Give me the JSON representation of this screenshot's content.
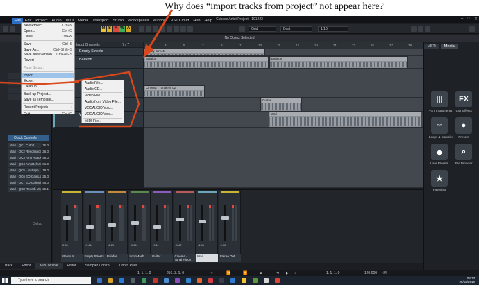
{
  "question": "Why does “import tracks from project” not appear here?",
  "app": {
    "title": "Cubase Artist Project - 191222",
    "menubar": [
      "File",
      "Edit",
      "Project",
      "Audio",
      "MIDI",
      "Media",
      "Transport",
      "Studio",
      "Workspaces",
      "Window",
      "VST Cloud",
      "Hub",
      "Help"
    ],
    "msrw": [
      "M",
      "S",
      "R",
      "W",
      "A"
    ],
    "grid_label": "Grid",
    "snap_value": "Beat",
    "quantize_value": "1/16",
    "info_line": "No Object Selected",
    "colors": {
      "accent": "#2d6fc3",
      "menu_highlight": "#9ec3ea",
      "annotation": "#d9471a"
    }
  },
  "file_menu": [
    {
      "label": "New Project...",
      "shortcut": "Ctrl+N"
    },
    {
      "label": "Open...",
      "shortcut": "Ctrl+O"
    },
    {
      "label": "Close",
      "shortcut": "Ctrl+W"
    },
    {
      "label": "Save",
      "shortcut": "Ctrl+S"
    },
    {
      "label": "Save As...",
      "shortcut": "Ctrl+Shift+S"
    },
    {
      "label": "Save New Version",
      "shortcut": "Ctrl+Alt+S"
    },
    {
      "label": "Revert",
      "shortcut": ""
    },
    {
      "label": "Page Setup...",
      "shortcut": ""
    },
    {
      "label": "Import",
      "shortcut": ""
    },
    {
      "label": "Export",
      "shortcut": ""
    },
    {
      "label": "Cleanup...",
      "shortcut": ""
    },
    {
      "label": "Back up Project...",
      "shortcut": ""
    },
    {
      "label": "Save as Template...",
      "shortcut": ""
    },
    {
      "label": "Recent Projects",
      "shortcut": ""
    },
    {
      "label": "Quit",
      "shortcut": "Ctrl+Q"
    }
  ],
  "import_submenu": [
    "Audio File...",
    "Audio CD...",
    "Video File...",
    "Audio from Video File...",
    "VOCALOID Voic...",
    "VOCALOID Voic...",
    "MIDI File..."
  ],
  "inspector": {
    "header": "Input Channels",
    "quick_controls_title": "Quick Controls",
    "quick_controls": [
      {
        "name": "Wail - QC1 Cutoff",
        "value": "75.0"
      },
      {
        "name": "Wail - QC2 Resonance",
        "value": "26.0"
      },
      {
        "name": "Wail - QC3 Amp Attack",
        "value": "48.0"
      },
      {
        "name": "Wail - QC4 AmpRelease",
        "value": "61.0"
      },
      {
        "name": "Wail - QC5 ...oshape",
        "value": "18.0"
      },
      {
        "name": "Wail - QC6 EQ GainLow",
        "value": "25.0"
      },
      {
        "name": "Wail - QC7 EQ GainMid",
        "value": "45.0"
      },
      {
        "name": "Wail - QC8 Reverb Mix",
        "value": "25.1"
      }
    ],
    "setup_label": "Setup"
  },
  "tracks": {
    "counter": "7 / 7",
    "rows": [
      "Empty Streets",
      "Balafon",
      "",
      "",
      "",
      "Wail"
    ]
  },
  "arrange": {
    "ruler": [
      "1",
      "3",
      "5",
      "7",
      "9",
      "11",
      "13",
      "15",
      "17",
      "19",
      "21",
      "23",
      "25",
      "27",
      "29"
    ],
    "clips": [
      {
        "name": "Empty Streets",
        "row": 0
      },
      {
        "name": "Balafon",
        "row": 1
      },
      {
        "name": "Balafon",
        "row": 1
      },
      {
        "name": "Cinema - Tonal Hit 02",
        "row": 3
      },
      {
        "name": "Guitar",
        "row": 4
      },
      {
        "name": "Wail",
        "row": 5
      }
    ]
  },
  "media": {
    "tabs": [
      "VSTi",
      "Media"
    ],
    "items": [
      {
        "label": "VST Instruments",
        "glyph": "|||"
      },
      {
        "label": "VST Effects",
        "glyph": "FX"
      },
      {
        "label": "Loops & Samples",
        "glyph": "◦◦"
      },
      {
        "label": "Presets",
        "glyph": "●"
      },
      {
        "label": "User Presets",
        "glyph": "◆"
      },
      {
        "label": "File Browser",
        "glyph": "⌕"
      },
      {
        "label": "Favorites",
        "glyph": "★"
      }
    ]
  },
  "mixer": {
    "strips": [
      {
        "name": "Stereo In",
        "db": "0.00",
        "vol": "0.00"
      },
      {
        "name": "Empty Streets",
        "db": "-9.44",
        "vol": "0.00"
      },
      {
        "name": "Balafon",
        "db": "-6.89",
        "vol": "0.00"
      },
      {
        "name": "LoopMash",
        "db": "-9.16",
        "vol": "0.00"
      },
      {
        "name": "Guitar",
        "db": "-9.11",
        "vol": "0.00"
      },
      {
        "name": "Cinema - Tonal Hit 02",
        "db": "-1.47",
        "vol": "0.00"
      },
      {
        "name": "Wail",
        "db": "-1.91",
        "vol": "0.00"
      },
      {
        "name": "Stereo Out",
        "db": "0.00",
        "vol": "0.00"
      }
    ]
  },
  "bottom_tabs": [
    "Track",
    "Editor",
    "MixConsole",
    "Editor",
    "Sampler Control",
    "Chord Pads"
  ],
  "transport": {
    "left_locator": "1. 1. 1. 0",
    "right_locator": "256. 3. 1. 0",
    "position": "1. 1. 1. 0",
    "tempo": "120.000",
    "signature": "4/4"
  },
  "taskbar": {
    "search_placeholder": "Type here to search",
    "time": "08:13",
    "date": "25/12/2019"
  }
}
